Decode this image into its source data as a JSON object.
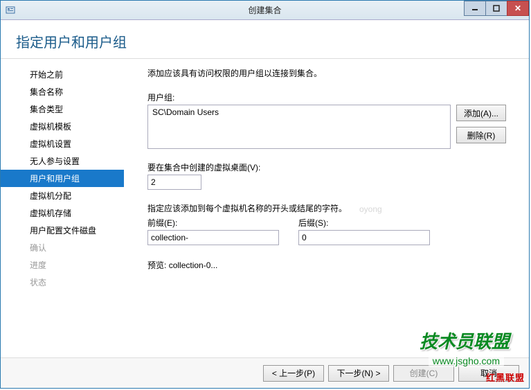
{
  "window": {
    "title": "创建集合"
  },
  "page": {
    "title": "指定用户和用户组"
  },
  "sidebar": {
    "items": [
      {
        "label": "开始之前",
        "state": "normal"
      },
      {
        "label": "集合名称",
        "state": "normal"
      },
      {
        "label": "集合类型",
        "state": "normal"
      },
      {
        "label": "虚拟机模板",
        "state": "normal"
      },
      {
        "label": "虚拟机设置",
        "state": "normal"
      },
      {
        "label": "无人参与设置",
        "state": "normal"
      },
      {
        "label": "用户和用户组",
        "state": "selected"
      },
      {
        "label": "虚拟机分配",
        "state": "normal"
      },
      {
        "label": "虚拟机存储",
        "state": "normal"
      },
      {
        "label": "用户配置文件磁盘",
        "state": "normal"
      },
      {
        "label": "确认",
        "state": "disabled"
      },
      {
        "label": "进度",
        "state": "disabled"
      },
      {
        "label": "状态",
        "state": "disabled"
      }
    ]
  },
  "main": {
    "instruction": "添加应该具有访问权限的用户组以连接到集合。",
    "group_label": "用户组:",
    "group_items": [
      "SC\\Domain Users"
    ],
    "add_label": "添加(A)...",
    "remove_label": "删除(R)",
    "vd_count_label": "要在集合中创建的虚拟桌面(V):",
    "vd_count_value": "2",
    "naming_instruction": "指定应该添加到每个虚拟机名称的开头或结尾的字符。",
    "prefix_label": "前缀(E):",
    "prefix_value": "collection-",
    "suffix_label": "后缀(S):",
    "suffix_value": "0",
    "preview_label": "预览:",
    "preview_value": "collection-0..."
  },
  "footer": {
    "prev": "< 上一步(P)",
    "next": "下一步(N) >",
    "create": "创建(C)",
    "cancel": "取消"
  },
  "watermarks": {
    "w1": "技术员联盟",
    "w2": "www.jsgho.com",
    "w3": "红黑联盟"
  },
  "ghost": "oyong"
}
